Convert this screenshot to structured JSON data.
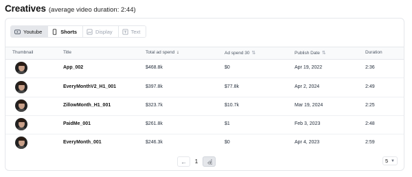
{
  "header": {
    "title": "Creatives",
    "subtitle": "(average video duration: 2:44)"
  },
  "tabs": [
    {
      "label": "Youtube",
      "icon": "youtube-icon"
    },
    {
      "label": "Shorts",
      "icon": "phone-icon"
    },
    {
      "label": "Display",
      "icon": "image-icon"
    },
    {
      "label": "Text",
      "icon": "text-icon"
    }
  ],
  "table": {
    "headers": {
      "thumbnail": "Thumbnail",
      "title": "Title",
      "total_ad_spend": "Total ad spend",
      "ad_spend_30": "Ad spend 30",
      "publish_date": "Publish Date",
      "duration": "Duration"
    },
    "rows": [
      {
        "title": "App_002",
        "total_ad_spend": "$468.8k",
        "ad_spend_30": "$0",
        "publish_date": "Apr 19, 2022",
        "duration": "2:36"
      },
      {
        "title": "EveryMonthV2_H1_001",
        "total_ad_spend": "$397.8k",
        "ad_spend_30": "$77.8k",
        "publish_date": "Apr 2, 2024",
        "duration": "2:49"
      },
      {
        "title": "ZillowMonth_H1_001",
        "total_ad_spend": "$323.7k",
        "ad_spend_30": "$10.7k",
        "publish_date": "Mar 19, 2024",
        "duration": "2:25"
      },
      {
        "title": "PaidMe_001",
        "total_ad_spend": "$261.8k",
        "ad_spend_30": "$1",
        "publish_date": "Feb 3, 2023",
        "duration": "2:48"
      },
      {
        "title": "EveryMonth_001",
        "total_ad_spend": "$246.3k",
        "ad_spend_30": "$0",
        "publish_date": "Apr 4, 2023",
        "duration": "2:59"
      }
    ]
  },
  "pagination": {
    "current_page": "1",
    "page_size": "5"
  }
}
